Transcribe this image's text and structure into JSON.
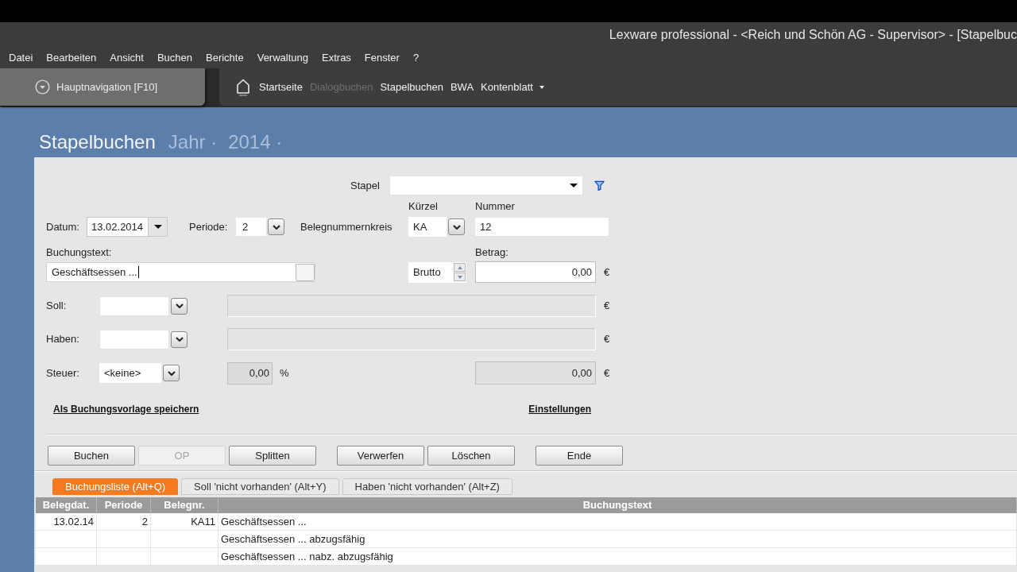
{
  "window": {
    "title": "Lexware professional - <Reich und Schön AG - Supervisor> - [Stapelbuc"
  },
  "menu": [
    "Datei",
    "Bearbeiten",
    "Ansicht",
    "Buchen",
    "Berichte",
    "Verwaltung",
    "Extras",
    "Fenster",
    "?"
  ],
  "navigation": {
    "main_button": "Hauptnavigation [F10]",
    "links": [
      {
        "label": "Startseite",
        "disabled": false,
        "has_menu": false
      },
      {
        "label": "Dialogbuchen",
        "disabled": true,
        "has_menu": false
      },
      {
        "label": "Stapelbuchen",
        "disabled": false,
        "has_menu": false
      },
      {
        "label": "BWA",
        "disabled": false,
        "has_menu": false
      },
      {
        "label": "Kontenblatt",
        "disabled": false,
        "has_menu": true
      }
    ]
  },
  "page": {
    "title": "Stapelbuchen",
    "filters": [
      "Jahr ·",
      "2014 ·"
    ]
  },
  "form": {
    "stapel": {
      "label": "Stapel"
    },
    "datum": {
      "label": "Datum:",
      "value": "13.02.2014"
    },
    "periode": {
      "label": "Periode:",
      "value": "2"
    },
    "belegnummernkreis": {
      "label": "Belegnummernkreis",
      "kuerzel": {
        "label": "Kürzel",
        "value": "KA"
      },
      "nummer": {
        "label": "Nummer",
        "value": "12"
      }
    },
    "buchungstext": {
      "label": "Buchungstext:",
      "value": "Geschäftsessen ...",
      "focused": true
    },
    "betrag": {
      "mode": "Brutto",
      "label": "Betrag:",
      "value": "0,00",
      "currency": "€"
    },
    "soll": {
      "label": "Soll:",
      "currency": "€"
    },
    "haben": {
      "label": "Haben:",
      "currency": "€"
    },
    "steuer": {
      "label": "Steuer:",
      "value": "<keine>",
      "rate": "0,00",
      "rate_unit": "%",
      "amount": "0,00",
      "currency": "€"
    }
  },
  "links": [
    {
      "label": "Als Buchungsvorlage speichern"
    },
    {
      "label": "Einstellungen"
    }
  ],
  "button_groups": [
    [
      {
        "label": "Buchen",
        "disabled": false
      },
      {
        "label": "OP",
        "disabled": true
      },
      {
        "label": "Splitten",
        "disabled": false
      }
    ],
    [
      {
        "label": "Verwerfen",
        "disabled": false
      },
      {
        "label": "Löschen",
        "disabled": false
      }
    ],
    [
      {
        "label": "Ende",
        "disabled": false
      }
    ]
  ],
  "tabs": [
    {
      "label": "Buchungsliste (Alt+Q)",
      "selected": true
    },
    {
      "label": "Soll 'nicht vorhanden' (Alt+Y)",
      "selected": false
    },
    {
      "label": "Haben 'nicht vorhanden' (Alt+Z)",
      "selected": false
    }
  ],
  "table": {
    "columns": [
      "Belegdat.",
      "Periode",
      "Belegnr.",
      "Buchungstext"
    ],
    "rows": [
      [
        "13.02.14",
        "2",
        "KA11",
        "Geschäftsessen ..."
      ],
      [
        null,
        null,
        null,
        "Geschäftsessen ... abzugsfähig"
      ],
      [
        null,
        null,
        null,
        "Geschäftsessen ... nabz. abzugsfähig"
      ]
    ]
  }
}
